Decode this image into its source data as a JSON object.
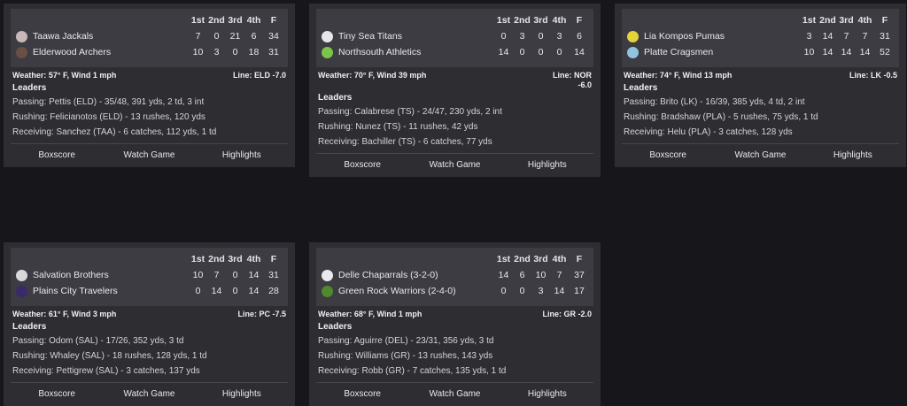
{
  "headers": {
    "q1": "1st",
    "q2": "2nd",
    "q3": "3rd",
    "q4": "4th",
    "f": "F"
  },
  "leaders_title": "Leaders",
  "actions": {
    "boxscore": "Boxscore",
    "watch": "Watch Game",
    "highlights": "Highlights"
  },
  "games": [
    {
      "away": {
        "name": "Taawa Jackals",
        "q": [
          "7",
          "0",
          "21",
          "6"
        ],
        "f": "34",
        "logo_color": "#c9b8b8",
        "logo_icon": "jackal-logo"
      },
      "home": {
        "name": "Elderwood Archers",
        "q": [
          "10",
          "3",
          "0",
          "18"
        ],
        "f": "31",
        "logo_color": "#6b4f45",
        "logo_icon": "archer-logo"
      },
      "weather": "Weather: 57° F, Wind 1 mph",
      "line": "Line: ELD -7.0",
      "passing": "Passing: Pettis (ELD) - 35/48, 391 yds, 2 td, 3 int",
      "rushing": "Rushing: Felicianotos (ELD) - 13 rushes, 120 yds",
      "receiving": "Receiving: Sanchez (TAA) - 6 catches, 112 yds, 1 td"
    },
    {
      "away": {
        "name": "Tiny Sea Titans",
        "q": [
          "0",
          "3",
          "0",
          "3"
        ],
        "f": "6",
        "logo_color": "#e6e6ea",
        "logo_icon": "titan-logo"
      },
      "home": {
        "name": "Northsouth Athletics",
        "q": [
          "14",
          "0",
          "0",
          "0"
        ],
        "f": "14",
        "logo_color": "#7cc44a",
        "logo_icon": "athletics-logo"
      },
      "weather": "Weather: 70° F, Wind 39 mph",
      "line": "Line: NOR -6.0",
      "passing": "Passing: Calabrese (TS) - 24/47, 230 yds, 2 int",
      "rushing": "Rushing: Nunez (TS) - 11 rushes, 42 yds",
      "receiving": "Receiving: Bachiller (TS) - 6 catches, 77 yds"
    },
    {
      "away": {
        "name": "Lia Kompos Pumas",
        "q": [
          "3",
          "14",
          "7",
          "7"
        ],
        "f": "31",
        "logo_color": "#e4d43a",
        "logo_icon": "puma-logo"
      },
      "home": {
        "name": "Platte Cragsmen",
        "q": [
          "10",
          "14",
          "14",
          "14"
        ],
        "f": "52",
        "logo_color": "#8fc3e0",
        "logo_icon": "cragsmen-logo"
      },
      "weather": "Weather: 74° F, Wind 13 mph",
      "line": "Line: LK -0.5",
      "passing": "Passing: Brito (LK) - 16/39, 385 yds, 4 td, 2 int",
      "rushing": "Rushing: Bradshaw (PLA) - 5 rushes, 75 yds, 1 td",
      "receiving": "Receiving: Helu (PLA) - 3 catches, 128 yds"
    },
    {
      "away": {
        "name": "Salvation Brothers",
        "q": [
          "10",
          "7",
          "0",
          "14"
        ],
        "f": "31",
        "logo_color": "#d8d8dc",
        "logo_icon": "brothers-logo"
      },
      "home": {
        "name": "Plains City Travelers",
        "q": [
          "0",
          "14",
          "0",
          "14"
        ],
        "f": "28",
        "logo_color": "#3a2a6a",
        "logo_icon": "travelers-logo"
      },
      "weather": "Weather: 61° F, Wind 3 mph",
      "line": "Line: PC -7.5",
      "passing": "Passing: Odom (SAL) - 17/26, 352 yds, 3 td",
      "rushing": "Rushing: Whaley (SAL) - 18 rushes, 128 yds, 1 td",
      "receiving": "Receiving: Pettigrew (SAL) - 3 catches, 137 yds"
    },
    {
      "away": {
        "name": "Delle Chaparrals (3-2-0)",
        "q": [
          "14",
          "6",
          "10",
          "7"
        ],
        "f": "37",
        "logo_color": "#eaeaee",
        "logo_icon": "chaparrals-logo"
      },
      "home": {
        "name": "Green Rock Warriors (2-4-0)",
        "q": [
          "0",
          "0",
          "3",
          "14"
        ],
        "f": "17",
        "logo_color": "#4f8a2e",
        "logo_icon": "warriors-logo"
      },
      "weather": "Weather: 68° F, Wind 1 mph",
      "line": "Line: GR -2.0",
      "passing": "Passing: Aguirre (DEL) - 23/31, 356 yds, 3 td",
      "rushing": "Rushing: Williams (GR) - 13 rushes, 143 yds",
      "receiving": "Receiving: Robb (GR) - 7 catches, 135 yds, 1 td"
    }
  ]
}
